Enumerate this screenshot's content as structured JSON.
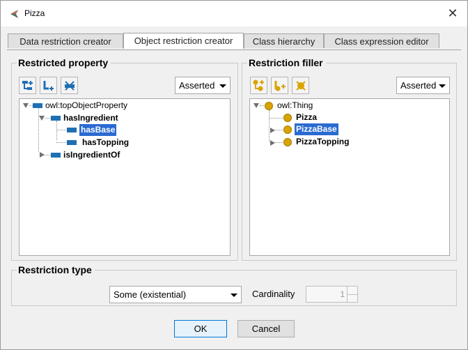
{
  "window": {
    "title": "Pizza",
    "close_glyph": "✕"
  },
  "tabs": [
    {
      "label": "Data restriction creator",
      "active": false
    },
    {
      "label": "Object restriction creator",
      "active": true
    },
    {
      "label": "Class hierarchy",
      "active": false
    },
    {
      "label": "Class expression editor",
      "active": false
    }
  ],
  "restricted_property": {
    "legend": "Restricted property",
    "mode": "Asserted",
    "tree": {
      "root": "owl:topObjectProperty",
      "has_ingredient": "hasIngredient",
      "has_base": "hasBase",
      "has_topping": "hasTopping",
      "is_ingredient_of": "isIngredientOf"
    },
    "selected": "hasBase"
  },
  "restriction_filler": {
    "legend": "Restriction filler",
    "mode": "Asserted",
    "tree": {
      "root": "owl:Thing",
      "pizza": "Pizza",
      "pizza_base": "PizzaBase",
      "pizza_topping": "PizzaTopping"
    },
    "selected": "PizzaBase"
  },
  "restriction_type": {
    "legend": "Restriction type",
    "selected": "Some (existential)",
    "cardinality_label": "Cardinality",
    "cardinality_value": "1"
  },
  "buttons": {
    "ok": "OK",
    "cancel": "Cancel"
  },
  "icons": {
    "app": "protege-icon",
    "property_tree_buttons": [
      "add-sub-property-icon",
      "add-sibling-property-icon",
      "delete-property-icon"
    ],
    "class_tree_buttons": [
      "add-subclass-icon",
      "add-sibling-class-icon",
      "delete-class-icon"
    ]
  },
  "colors": {
    "selection": "#2b6bd1",
    "property_icon": "#1f6fb5",
    "class_icon": "#d9a400",
    "default_button_border": "#0078d7"
  }
}
